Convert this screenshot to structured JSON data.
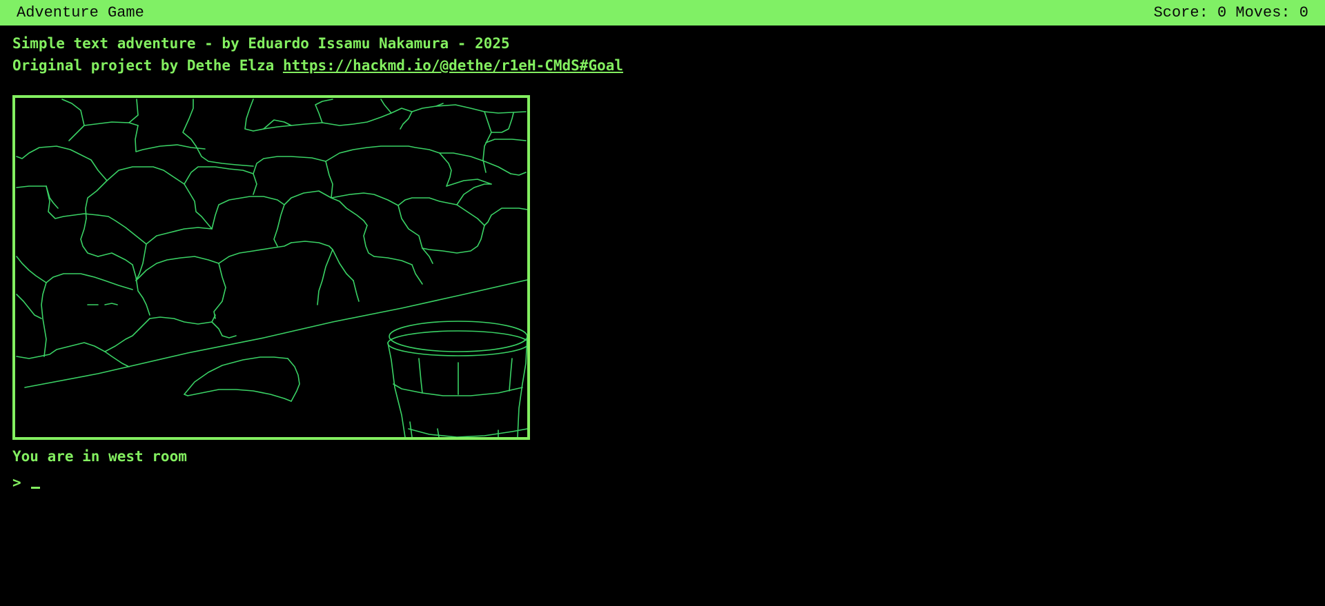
{
  "app": {
    "title": "Adventure Game",
    "status": "Score: 0 Moves: 0"
  },
  "intro": {
    "line1": "Simple text adventure - by Eduardo Issamu Nakamura - 2025",
    "line2_prefix": "Original project by Dethe Elza ",
    "link_text": "https://hackmd.io/@dethe/r1eH-CMdS#Goal"
  },
  "scene": {
    "icon": "stone-wall-and-bucket-illustration",
    "line_color": "#3ad265",
    "frame_color": "#83ef60"
  },
  "room": {
    "description": "You are in west room"
  },
  "prompt": {
    "symbol": ">",
    "value": ""
  },
  "colors": {
    "accent": "#83ef60",
    "background": "#000000",
    "titlebar_text": "#0a0a0a"
  }
}
